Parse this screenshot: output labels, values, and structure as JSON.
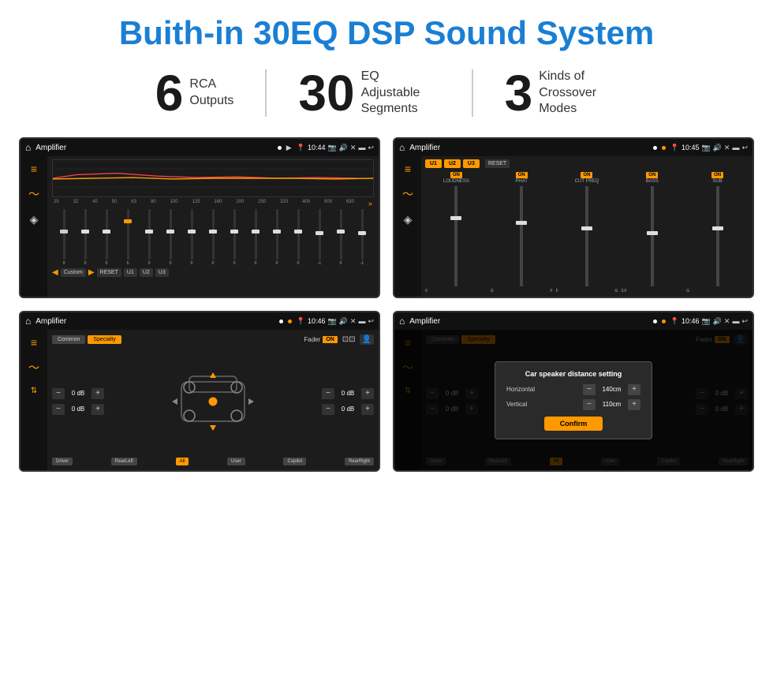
{
  "header": {
    "title": "Buith-in 30EQ DSP Sound System"
  },
  "stats": [
    {
      "number": "6",
      "label": "RCA\nOutputs"
    },
    {
      "number": "30",
      "label": "EQ Adjustable\nSegments"
    },
    {
      "number": "3",
      "label": "Kinds of\nCrossover Modes"
    }
  ],
  "screens": [
    {
      "id": "screen1",
      "status_bar": {
        "app": "Amplifier",
        "time": "10:44"
      },
      "type": "eq"
    },
    {
      "id": "screen2",
      "status_bar": {
        "app": "Amplifier",
        "time": "10:45"
      },
      "type": "crossover"
    },
    {
      "id": "screen3",
      "status_bar": {
        "app": "Amplifier",
        "time": "10:46"
      },
      "type": "fader"
    },
    {
      "id": "screen4",
      "status_bar": {
        "app": "Amplifier",
        "time": "10:46"
      },
      "type": "dialog"
    }
  ],
  "eq": {
    "frequencies": [
      "25",
      "32",
      "40",
      "50",
      "63",
      "80",
      "100",
      "125",
      "160",
      "200",
      "250",
      "320",
      "400",
      "500",
      "630"
    ],
    "values": [
      "0",
      "0",
      "0",
      "5",
      "0",
      "0",
      "0",
      "0",
      "0",
      "0",
      "0",
      "0",
      "-1",
      "0",
      "-1"
    ],
    "buttons": [
      "Custom",
      "RESET",
      "U1",
      "U2",
      "U3"
    ]
  },
  "crossover": {
    "presets": [
      "U1",
      "U2",
      "U3"
    ],
    "channels": [
      {
        "label": "LOUDNESS",
        "on": true
      },
      {
        "label": "PHAT",
        "on": true
      },
      {
        "label": "CUT FREQ",
        "on": true
      },
      {
        "label": "BASS",
        "on": true
      },
      {
        "label": "SUB",
        "on": true
      }
    ],
    "reset_label": "RESET"
  },
  "fader": {
    "modes": [
      "Common",
      "Specialty"
    ],
    "active_mode": "Specialty",
    "fader_label": "Fader",
    "fader_on": true,
    "volumes": [
      "0 dB",
      "0 dB",
      "0 dB",
      "0 dB"
    ],
    "bottom_buttons": [
      "Driver",
      "All",
      "User",
      "RearLeft",
      "Copilot",
      "RearRight"
    ]
  },
  "dialog": {
    "title": "Car speaker distance setting",
    "horizontal_label": "Horizontal",
    "horizontal_value": "140cm",
    "vertical_label": "Vertical",
    "vertical_value": "110cm",
    "confirm_label": "Confirm"
  }
}
